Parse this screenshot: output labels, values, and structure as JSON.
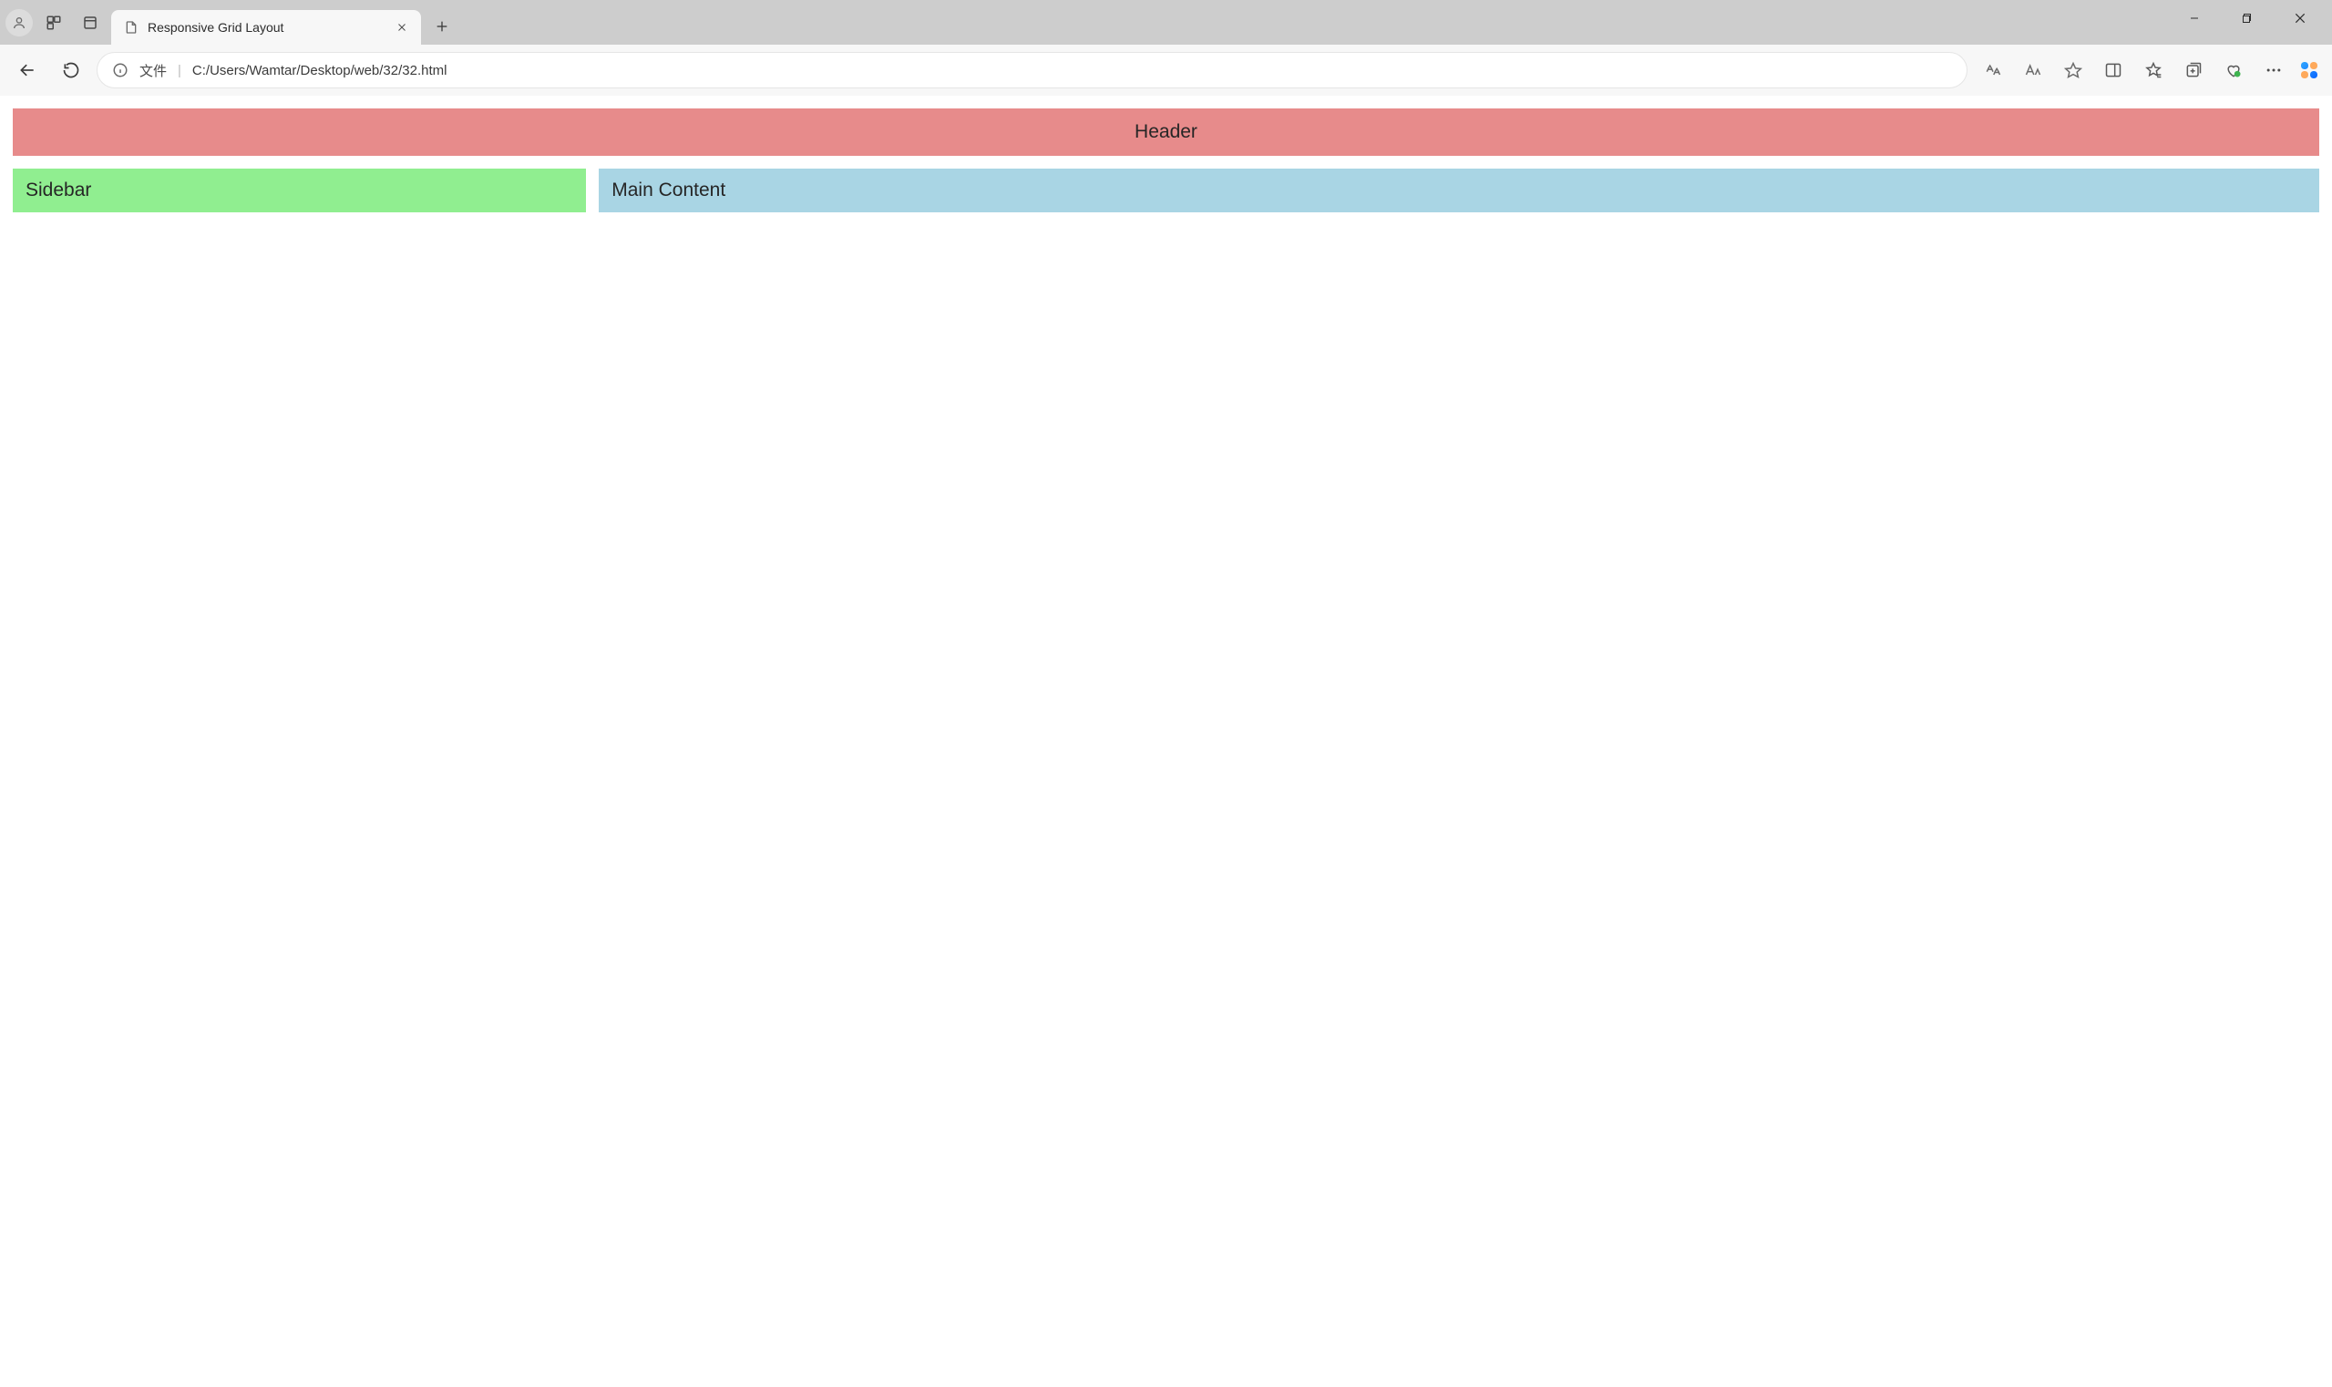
{
  "browser": {
    "tab_title": "Responsive Grid Layout",
    "file_label": "文件",
    "url": "C:/Users/Wamtar/Desktop/web/32/32.html"
  },
  "page": {
    "header": "Header",
    "sidebar": "Sidebar",
    "main": "Main Content"
  },
  "colors": {
    "header_bg": "#e78b8b",
    "sidebar_bg": "#90ee90",
    "main_bg": "#a9d5e4"
  }
}
